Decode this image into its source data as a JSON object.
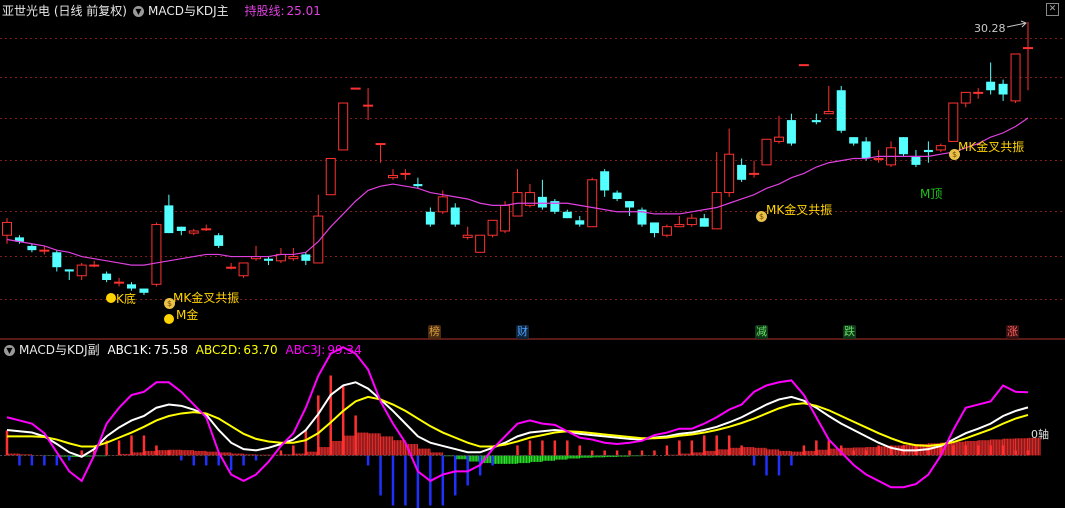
{
  "main_header": {
    "stock": "亚世光电 (日线 前复权)",
    "indicator": "MACD与KDJ主",
    "holding_line_label": "持股线:",
    "holding_line_value": "25.01"
  },
  "sub_header": {
    "indicator": "MACD与KDJ副",
    "k_label": "ABC1K:",
    "k_value": "75.58",
    "d_label": "ABC2D:",
    "d_value": "63.70",
    "j_label": "ABC3J:",
    "j_value": "99.34"
  },
  "peak_label": "30.28",
  "zero_axis_label": "0轴",
  "events": [
    {
      "text": "榜",
      "color": "#d4a040",
      "bg": "#4a2a10"
    },
    {
      "text": "财",
      "color": "#4aa0ff",
      "bg": "#10243a"
    },
    {
      "text": "减",
      "color": "#60e060",
      "bg": "#12381a"
    },
    {
      "text": "跌",
      "color": "#60e060",
      "bg": "#12381a"
    },
    {
      "text": "涨",
      "color": "#ff6060",
      "bg": "#3a1010"
    }
  ],
  "signals": [
    {
      "text": "MK金叉共振",
      "color": "#ffd400"
    },
    {
      "text": "MK金叉共振",
      "color": "#ffd400"
    },
    {
      "text": "MK金叉共振",
      "color": "#ffd400"
    },
    {
      "text": "M顶",
      "color": "#20c020"
    },
    {
      "text": "K底",
      "color": "#ffd400"
    },
    {
      "text": "M金",
      "color": "#ffd400"
    }
  ],
  "colors": {
    "up": "#ff3232",
    "down": "#54ffff",
    "ma": "#e040e0",
    "k": "#ffffff",
    "d": "#ffff00",
    "j": "#ff00ff",
    "bar_up": "#ff3030",
    "bar_down": "#2030ff",
    "bar_area": "#30ff30"
  },
  "chart_data": [
    {
      "type": "candlestick",
      "title": "亚世光电 (日线 前复权)",
      "ylim": [
        17.4,
        31.0
      ],
      "candles": [
        [
          21.0,
          21.6,
          20.6,
          21.8
        ],
        [
          20.9,
          20.7,
          20.6,
          21.0
        ],
        [
          20.5,
          20.3,
          20.2,
          20.6
        ],
        [
          20.3,
          20.3,
          20.1,
          20.5
        ],
        [
          20.2,
          19.5,
          19.3,
          20.3
        ],
        [
          19.4,
          19.3,
          18.9,
          19.4
        ],
        [
          19.1,
          19.6,
          18.9,
          19.7
        ],
        [
          19.6,
          19.6,
          19.5,
          19.8
        ],
        [
          19.2,
          18.9,
          18.8,
          19.3
        ],
        [
          18.8,
          18.8,
          18.6,
          19.0
        ],
        [
          18.7,
          18.5,
          18.4,
          18.8
        ],
        [
          18.5,
          18.3,
          18.2,
          18.5
        ],
        [
          18.7,
          21.5,
          18.6,
          21.6
        ],
        [
          22.4,
          21.1,
          21.1,
          22.9
        ],
        [
          21.4,
          21.2,
          21.0,
          21.4
        ],
        [
          21.1,
          21.2,
          21.0,
          21.3
        ],
        [
          21.3,
          21.3,
          21.2,
          21.5
        ],
        [
          21.0,
          20.5,
          20.4,
          21.1
        ],
        [
          19.5,
          19.5,
          19.4,
          19.7
        ],
        [
          19.1,
          19.7,
          19.0,
          19.7
        ],
        [
          19.9,
          20.0,
          19.8,
          20.5
        ],
        [
          19.9,
          19.8,
          19.6,
          20.0
        ],
        [
          19.8,
          20.1,
          19.7,
          20.4
        ],
        [
          19.9,
          20.0,
          19.8,
          20.4
        ],
        [
          20.1,
          19.8,
          19.6,
          20.2
        ],
        [
          19.7,
          21.9,
          19.7,
          22.9
        ],
        [
          22.9,
          24.6,
          22.9,
          24.6
        ],
        [
          25.0,
          27.2,
          25.0,
          27.2
        ],
        [
          27.9,
          27.9,
          27.9,
          27.9
        ],
        [
          27.1,
          27.1,
          26.4,
          27.9
        ],
        [
          25.3,
          25.3,
          24.4,
          25.3
        ],
        [
          23.7,
          23.8,
          23.6,
          24.1
        ],
        [
          23.9,
          23.9,
          23.6,
          24.1
        ],
        [
          23.4,
          23.3,
          23.2,
          23.7
        ],
        [
          22.1,
          21.5,
          21.4,
          22.3
        ],
        [
          22.1,
          22.8,
          22.0,
          23.1
        ],
        [
          22.3,
          21.5,
          21.4,
          22.5
        ],
        [
          20.9,
          21.0,
          20.8,
          21.4
        ],
        [
          20.2,
          21.0,
          20.2,
          21.0
        ],
        [
          21.0,
          21.7,
          20.9,
          21.7
        ],
        [
          21.2,
          22.4,
          21.1,
          22.6
        ],
        [
          21.9,
          23.0,
          21.9,
          24.1
        ],
        [
          22.4,
          23.0,
          22.3,
          23.4
        ],
        [
          22.8,
          22.3,
          22.2,
          23.6
        ],
        [
          22.6,
          22.1,
          22.0,
          22.7
        ],
        [
          22.1,
          21.8,
          21.8,
          22.2
        ],
        [
          21.7,
          21.5,
          21.4,
          21.9
        ],
        [
          21.4,
          23.6,
          21.4,
          23.7
        ],
        [
          24.0,
          23.1,
          22.8,
          24.1
        ],
        [
          23.0,
          22.7,
          22.6,
          23.1
        ],
        [
          22.6,
          22.3,
          21.9,
          22.6
        ],
        [
          22.2,
          21.5,
          21.4,
          22.3
        ],
        [
          21.6,
          21.1,
          20.9,
          21.6
        ],
        [
          21.0,
          21.4,
          20.9,
          21.5
        ],
        [
          21.4,
          21.5,
          21.4,
          21.9
        ],
        [
          21.5,
          21.8,
          21.4,
          22.0
        ],
        [
          21.8,
          21.4,
          21.4,
          22.0
        ],
        [
          21.3,
          23.0,
          21.3,
          24.9
        ],
        [
          23.0,
          24.8,
          22.8,
          26.0
        ],
        [
          24.3,
          23.6,
          23.5,
          24.6
        ],
        [
          23.9,
          23.9,
          23.7,
          24.5
        ],
        [
          24.3,
          25.5,
          24.3,
          25.5
        ],
        [
          25.4,
          25.6,
          25.3,
          26.6
        ],
        [
          26.4,
          25.3,
          25.2,
          26.7
        ],
        [
          29.0,
          29.0,
          29.0,
          29.0
        ],
        [
          26.4,
          26.3,
          26.2,
          26.7
        ],
        [
          26.7,
          26.8,
          26.7,
          28.0
        ],
        [
          27.8,
          25.9,
          25.8,
          28.0
        ],
        [
          25.6,
          25.3,
          25.2,
          25.6
        ],
        [
          25.4,
          24.6,
          24.5,
          25.6
        ],
        [
          24.6,
          24.6,
          24.4,
          25.0
        ],
        [
          24.3,
          25.1,
          24.2,
          25.4
        ],
        [
          25.6,
          24.8,
          24.7,
          25.6
        ],
        [
          24.7,
          24.3,
          24.2,
          25.0
        ],
        [
          25.0,
          24.9,
          24.4,
          25.4
        ],
        [
          25.0,
          25.2,
          24.9,
          25.3
        ],
        [
          25.4,
          27.2,
          25.4,
          27.2
        ],
        [
          27.2,
          27.7,
          27.0,
          27.7
        ],
        [
          27.7,
          27.7,
          27.4,
          27.9
        ],
        [
          28.2,
          27.8,
          27.6,
          29.1
        ],
        [
          28.1,
          27.6,
          27.3,
          28.3
        ],
        [
          27.3,
          29.5,
          27.2,
          29.5
        ],
        [
          29.8,
          29.8,
          27.8,
          31.0
        ]
      ],
      "ma_line": [
        20.8,
        20.7,
        20.6,
        20.5,
        20.3,
        20.2,
        20.0,
        19.9,
        19.8,
        19.7,
        19.6,
        19.6,
        19.7,
        19.8,
        19.9,
        20.0,
        20.1,
        20.1,
        20.0,
        20.0,
        20.0,
        20.0,
        20.1,
        20.1,
        20.2,
        20.7,
        21.4,
        22.0,
        22.6,
        23.1,
        23.3,
        23.4,
        23.3,
        23.2,
        23.0,
        22.9,
        22.8,
        22.7,
        22.5,
        22.4,
        22.4,
        22.5,
        22.5,
        22.5,
        22.5,
        22.5,
        22.4,
        22.3,
        22.2,
        22.1,
        22.1,
        22.1,
        22.0,
        22.0,
        22.0,
        22.1,
        22.2,
        22.3,
        22.5,
        22.7,
        22.9,
        23.2,
        23.4,
        23.7,
        23.9,
        24.2,
        24.4,
        24.5,
        24.6,
        24.6,
        24.7,
        24.7,
        24.7,
        24.7,
        24.7,
        24.8,
        24.9,
        25.1,
        25.3,
        25.6,
        25.8,
        26.1,
        26.5
      ]
    },
    {
      "type": "line",
      "title": "MACD与KDJ副",
      "ylim": [
        -70,
        150
      ],
      "series": [
        {
          "name": "ABC1K",
          "values": [
            40,
            38,
            36,
            30,
            18,
            5,
            -2,
            10,
            30,
            44,
            55,
            62,
            75,
            80,
            78,
            72,
            64,
            40,
            20,
            10,
            8,
            12,
            18,
            25,
            40,
            65,
            95,
            110,
            115,
            105,
            88,
            70,
            50,
            30,
            20,
            15,
            10,
            5,
            5,
            12,
            20,
            30,
            36,
            38,
            40,
            38,
            34,
            32,
            30,
            28,
            26,
            25,
            28,
            30,
            34,
            36,
            40,
            45,
            52,
            60,
            70,
            80,
            88,
            92,
            86,
            75,
            62,
            50,
            40,
            30,
            20,
            12,
            8,
            8,
            10,
            15,
            25,
            35,
            42,
            50,
            62,
            70,
            75.58
          ]
        },
        {
          "name": "ABC2D",
          "values": [
            30,
            30,
            30,
            29,
            25,
            19,
            14,
            14,
            20,
            28,
            36,
            45,
            55,
            62,
            66,
            68,
            66,
            58,
            46,
            34,
            26,
            22,
            20,
            20,
            24,
            35,
            52,
            70,
            85,
            92,
            88,
            80,
            70,
            58,
            46,
            36,
            28,
            20,
            14,
            14,
            17,
            22,
            28,
            32,
            36,
            38,
            37,
            35,
            33,
            31,
            29,
            27,
            27,
            28,
            31,
            33,
            36,
            40,
            45,
            51,
            58,
            66,
            74,
            80,
            82,
            78,
            71,
            62,
            53,
            44,
            35,
            27,
            20,
            16,
            15,
            17,
            21,
            27,
            34,
            41,
            50,
            58,
            63.7
          ]
        },
        {
          "name": "ABC3J",
          "values": [
            60,
            55,
            50,
            35,
            5,
            -25,
            -40,
            0,
            50,
            75,
            95,
            100,
            115,
            115,
            100,
            80,
            60,
            5,
            -30,
            -40,
            -30,
            -10,
            15,
            35,
            75,
            125,
            160,
            170,
            160,
            135,
            85,
            50,
            20,
            -25,
            -40,
            -30,
            -25,
            -25,
            -15,
            10,
            30,
            50,
            55,
            50,
            48,
            38,
            28,
            25,
            20,
            18,
            20,
            23,
            32,
            36,
            42,
            42,
            50,
            60,
            72,
            80,
            100,
            110,
            115,
            118,
            95,
            60,
            25,
            5,
            -15,
            -30,
            -40,
            -50,
            -50,
            -45,
            -30,
            0,
            40,
            75,
            80,
            85,
            110,
            100,
            99.34
          ]
        },
        {
          "name": "MACD",
          "values": [
            5,
            3,
            1,
            -1,
            -3,
            -4,
            -3,
            -2,
            1,
            4,
            8,
            12,
            14,
            15,
            14,
            12,
            10,
            8,
            5,
            3,
            2,
            2,
            3,
            5,
            10,
            22,
            38,
            52,
            60,
            58,
            50,
            40,
            30,
            18,
            8,
            -2,
            -10,
            -16,
            -20,
            -22,
            -22,
            -20,
            -17,
            -14,
            -11,
            -8,
            -6,
            -5,
            -4,
            -3,
            -2,
            -1,
            0,
            2,
            5,
            8,
            12,
            16,
            20,
            22,
            20,
            16,
            12,
            10,
            12,
            15,
            18,
            20,
            21,
            22,
            24,
            26,
            28,
            30,
            32,
            34,
            36,
            38,
            40,
            42,
            44,
            45,
            46
          ]
        }
      ]
    }
  ]
}
